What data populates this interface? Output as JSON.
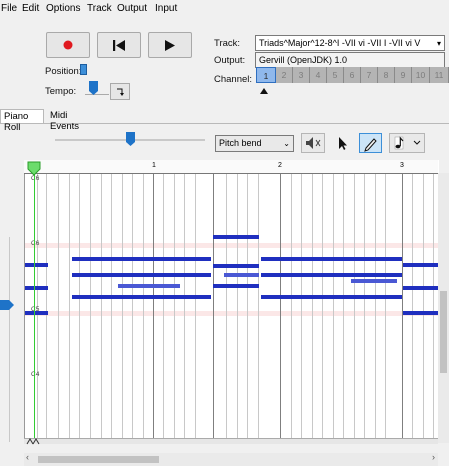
{
  "menu": [
    "File",
    "Edit",
    "Options",
    "Track",
    "Output",
    "Input"
  ],
  "transport": {
    "record_icon": "record-icon",
    "rewind_icon": "skip-to-start-icon",
    "play_icon": "play-icon",
    "position_label": "Position:",
    "tempo_label": "Tempo:"
  },
  "track": {
    "label": "Track:",
    "value": "Triads^Major^12-8^I -VII vi -VII I -VII vi V"
  },
  "output": {
    "label": "Output:",
    "value": "Gervill (OpenJDK) 1.0"
  },
  "channel": {
    "label": "Channel:",
    "numbers": [
      "1",
      "2",
      "3",
      "4",
      "5",
      "6",
      "7",
      "8",
      "9",
      "10",
      "11"
    ],
    "selected": "1"
  },
  "tabs": [
    "Piano Roll",
    "Midi Events"
  ],
  "controller_select": "Pitch bend",
  "ruler": {
    "bars": [
      "1",
      "2",
      "3"
    ]
  },
  "octaves": [
    "C6",
    "C5",
    "C4"
  ],
  "colors": {
    "note": "#1f2fbf",
    "accent": "#1e73c8",
    "playhead": "#33cc33"
  }
}
